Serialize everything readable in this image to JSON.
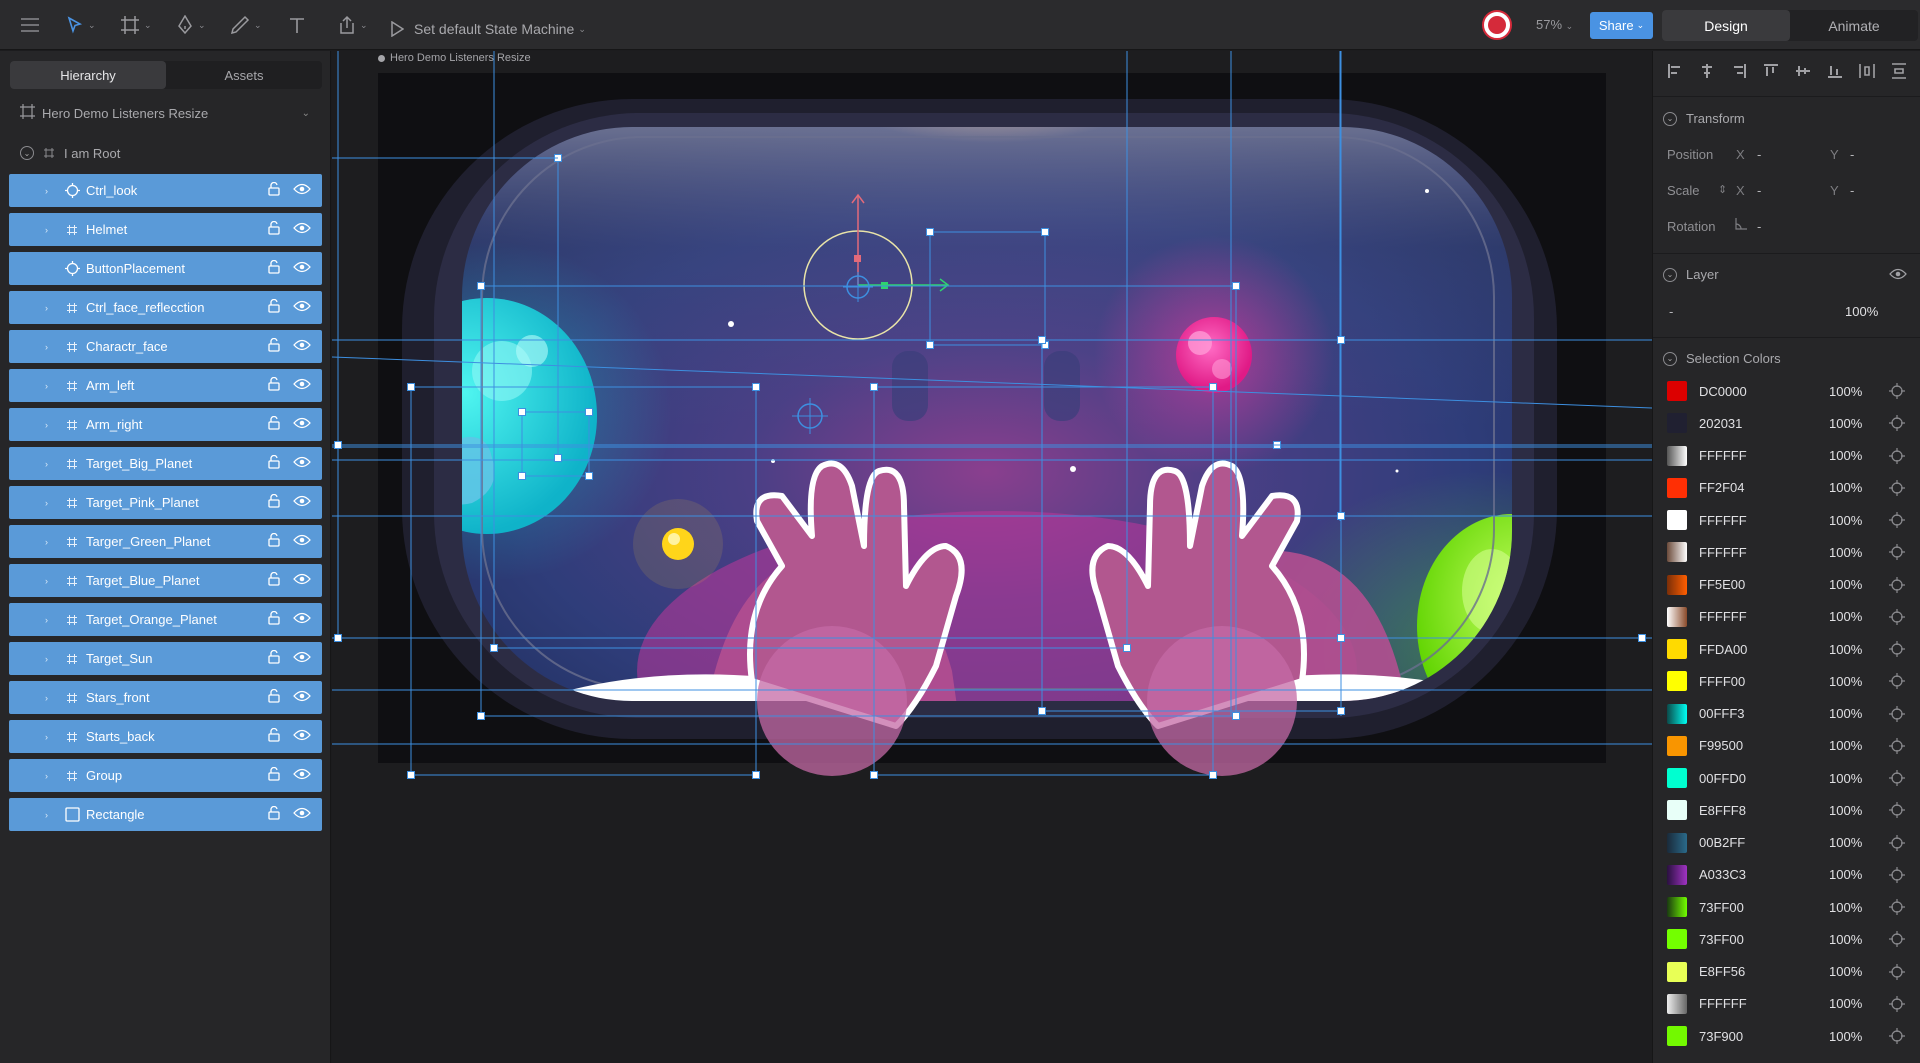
{
  "toolbar": {
    "state_machine_label": "Set default State Machine",
    "zoom": "57%",
    "share_label": "Share",
    "modes": [
      "Design",
      "Animate"
    ],
    "active_mode": "Design"
  },
  "left_panel": {
    "tabs": [
      "Hierarchy",
      "Assets"
    ],
    "active_tab": "Hierarchy",
    "artboard_name": "Hero Demo Listeners Resize",
    "root_name": "I am Root",
    "layers": [
      {
        "name": "Ctrl_look",
        "icon": "target-icon"
      },
      {
        "name": "Helmet",
        "icon": "group-icon"
      },
      {
        "name": "ButtonPlacement",
        "icon": "target-icon"
      },
      {
        "name": "Ctrl_face_reflecction",
        "icon": "group-icon"
      },
      {
        "name": "Charactr_face",
        "icon": "group-icon"
      },
      {
        "name": "Arm_left",
        "icon": "group-icon"
      },
      {
        "name": "Arm_right",
        "icon": "group-icon"
      },
      {
        "name": "Target_Big_Planet",
        "icon": "group-icon"
      },
      {
        "name": "Target_Pink_Planet",
        "icon": "group-icon"
      },
      {
        "name": "Targer_Green_Planet",
        "icon": "group-icon"
      },
      {
        "name": "Target_Blue_Planet",
        "icon": "group-icon"
      },
      {
        "name": "Target_Orange_Planet",
        "icon": "group-icon"
      },
      {
        "name": "Target_Sun",
        "icon": "group-icon"
      },
      {
        "name": "Stars_front",
        "icon": "group-icon"
      },
      {
        "name": "Starts_back",
        "icon": "group-icon"
      },
      {
        "name": "Group",
        "icon": "group-icon"
      },
      {
        "name": "Rectangle",
        "icon": "rectangle-icon"
      }
    ]
  },
  "canvas": {
    "artboard_label": "Hero Demo Listeners Resize"
  },
  "right_panel": {
    "transform": {
      "title": "Transform",
      "position_label": "Position",
      "scale_label": "Scale",
      "rotation_label": "Rotation",
      "x_label": "X",
      "y_label": "Y",
      "position_x": "-",
      "position_y": "-",
      "scale_x": "-",
      "scale_y": "-",
      "rotation": "-"
    },
    "layer": {
      "title": "Layer",
      "blend": "-",
      "opacity": "100%"
    },
    "selection_colors": {
      "title": "Selection Colors",
      "colors": [
        {
          "hex": "DC0000",
          "pct": "100%",
          "swatch": "#DC0000"
        },
        {
          "hex": "202031",
          "pct": "100%",
          "swatch": "#202031"
        },
        {
          "hex": "FFFFFF",
          "pct": "100%",
          "swatch": "linear-gradient(90deg,#555,#fff)"
        },
        {
          "hex": "FF2F04",
          "pct": "100%",
          "swatch": "#FF2F04"
        },
        {
          "hex": "FFFFFF",
          "pct": "100%",
          "swatch": "#FFFFFF"
        },
        {
          "hex": "FFFFFF",
          "pct": "100%",
          "swatch": "linear-gradient(90deg,#6b4a3a,#fff)"
        },
        {
          "hex": "FF5E00",
          "pct": "100%",
          "swatch": "linear-gradient(90deg,#7a2e08,#FF5E00)"
        },
        {
          "hex": "FFFFFF",
          "pct": "100%",
          "swatch": "linear-gradient(90deg,#fff,#8a4a2a)"
        },
        {
          "hex": "FFDA00",
          "pct": "100%",
          "swatch": "#FFDA00"
        },
        {
          "hex": "FFFF00",
          "pct": "100%",
          "swatch": "#FFFF00"
        },
        {
          "hex": "00FFF3",
          "pct": "100%",
          "swatch": "linear-gradient(90deg,#0a4a4a,#00FFF3)"
        },
        {
          "hex": "F99500",
          "pct": "100%",
          "swatch": "#F99500"
        },
        {
          "hex": "00FFD0",
          "pct": "100%",
          "swatch": "#00FFD0"
        },
        {
          "hex": "E8FFF8",
          "pct": "100%",
          "swatch": "#E8FFF8"
        },
        {
          "hex": "00B2FF",
          "pct": "100%",
          "swatch": "linear-gradient(90deg,#1a2a3a,#2a6a8a)"
        },
        {
          "hex": "A033C3",
          "pct": "100%",
          "swatch": "linear-gradient(90deg,#2a1040,#A033C3)"
        },
        {
          "hex": "73FF00",
          "pct": "100%",
          "swatch": "linear-gradient(90deg,#1a3a10,#73FF00)"
        },
        {
          "hex": "73FF00",
          "pct": "100%",
          "swatch": "#73FF00"
        },
        {
          "hex": "E8FF56",
          "pct": "100%",
          "swatch": "#E8FF56"
        },
        {
          "hex": "FFFFFF",
          "pct": "100%",
          "swatch": "linear-gradient(90deg,#eee,#666)"
        },
        {
          "hex": "73F900",
          "pct": "100%",
          "swatch": "#73F900"
        }
      ]
    }
  },
  "theme": {
    "selection_blue": "#5a9ad8",
    "accent_blue": "#4a93e3",
    "guide_blue": "#3d8fe0"
  }
}
